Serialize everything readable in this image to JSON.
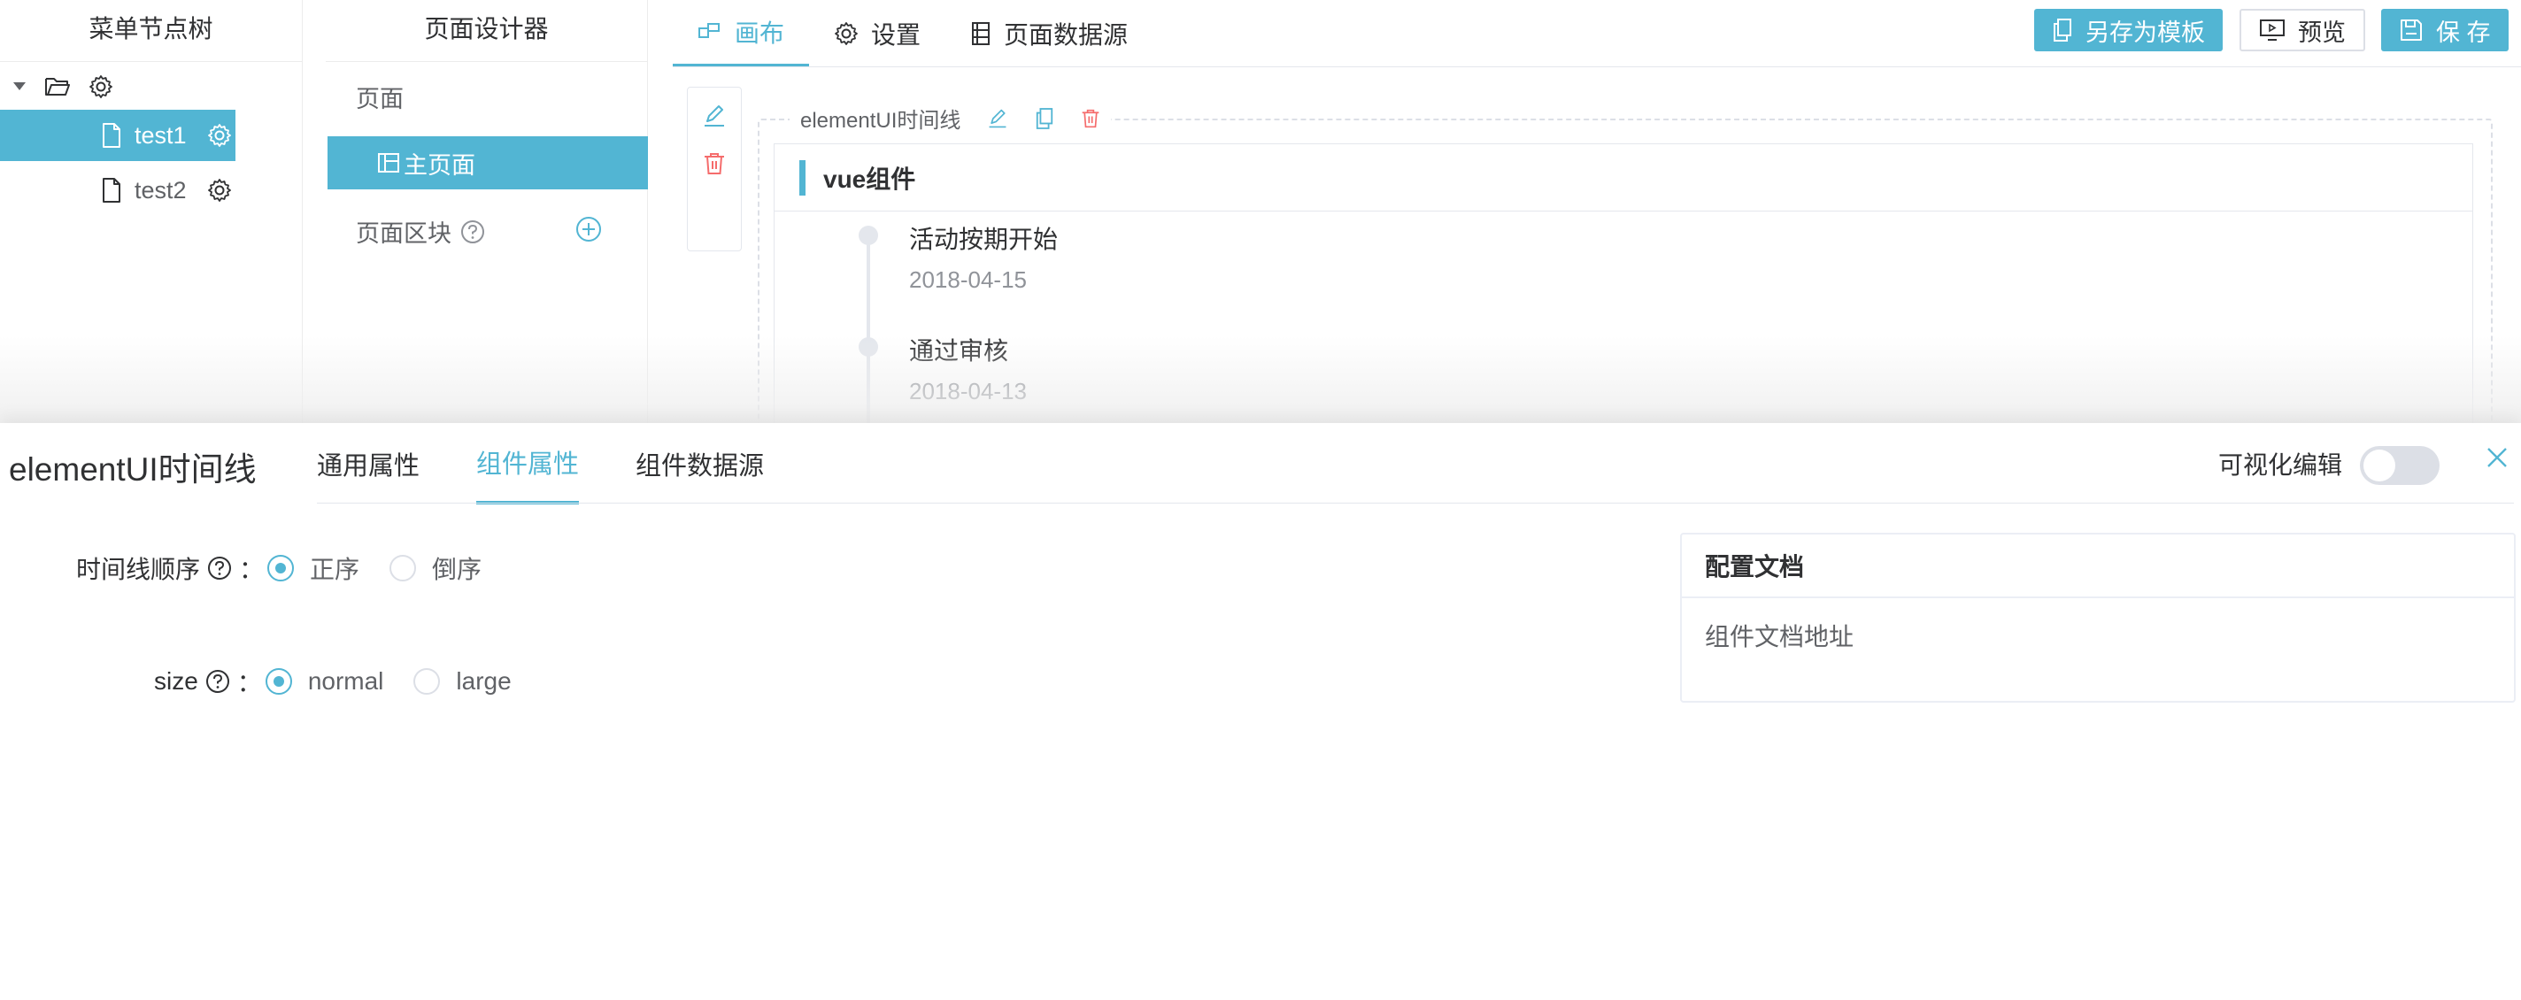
{
  "tree": {
    "title": "菜单节点树",
    "items": [
      {
        "label": "test1",
        "active": true
      },
      {
        "label": "test2",
        "active": false
      }
    ]
  },
  "designer": {
    "title": "页面设计器",
    "page_label": "页面",
    "main_page": "主页面",
    "block_label": "页面区块"
  },
  "canvas_tabs": [
    {
      "label": "画布",
      "icon": "canvas-icon",
      "active": true
    },
    {
      "label": "设置",
      "icon": "gear-icon",
      "active": false
    },
    {
      "label": "页面数据源",
      "icon": "datasource-icon",
      "active": false
    }
  ],
  "toolbar": {
    "save_template": "另存为模板",
    "preview": "预览",
    "save": "保 存"
  },
  "component": {
    "frame_label": "elementUI时间线",
    "card_title": "vue组件",
    "timeline": [
      {
        "content": "活动按期开始",
        "timestamp": "2018-04-15"
      },
      {
        "content": "通过审核",
        "timestamp": "2018-04-13"
      }
    ]
  },
  "drawer": {
    "title": "elementUI时间线",
    "tabs": [
      {
        "label": "通用属性",
        "active": false
      },
      {
        "label": "组件属性",
        "active": true
      },
      {
        "label": "组件数据源",
        "active": false
      }
    ],
    "visual_edit_label": "可视化编辑",
    "visual_edit_on": false,
    "fields": [
      {
        "label": "时间线顺序",
        "options": [
          {
            "label": "正序",
            "checked": true
          },
          {
            "label": "倒序",
            "checked": false
          }
        ]
      },
      {
        "label": "size",
        "options": [
          {
            "label": "normal",
            "checked": true
          },
          {
            "label": "large",
            "checked": false
          }
        ]
      }
    ],
    "doc": {
      "title": "配置文档",
      "link": "组件文档地址"
    }
  },
  "colors": {
    "accent": "#52b5d3",
    "danger": "#f56c6c",
    "border": "#e4e7ed"
  }
}
